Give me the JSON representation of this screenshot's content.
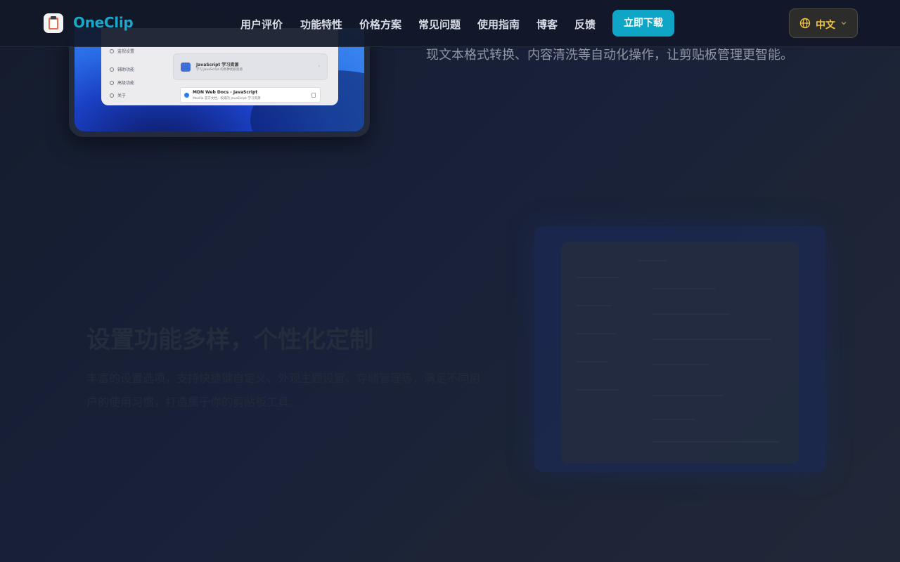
{
  "nav": {
    "brand": "OneClip",
    "links": [
      "用户评价",
      "功能特性",
      "价格方案",
      "常见问题",
      "使用指南",
      "博客",
      "反馈"
    ],
    "download_label": "立即下载",
    "language": "中文"
  },
  "mockup": {
    "sidebar_items": [
      "监视设置",
      "辅助功能",
      "高级功能",
      "关于"
    ],
    "card_title": "JavaScript 学习资源",
    "card_subtitle": "学习 JavaScript 的各种优质资源",
    "item_title": "MDN Web Docs - JavaScript",
    "item_subtitle": "Mozilla 官方文档，权威的 JavaScript 学习资源"
  },
  "top_description": "现文本格式转换、内容清洗等自动化操作，让剪贴板管理更智能。",
  "feature": {
    "title": "设置功能多样，个性化定制",
    "description": "丰富的设置选项，支持快捷键自定义、外观主题设置、存储管理等，满足不同用户的使用习惯，打造属于你的剪贴板工具。"
  },
  "colors": {
    "accent": "#0ea5c6",
    "brand": "#1aa7c9",
    "language": "#f4c542"
  }
}
